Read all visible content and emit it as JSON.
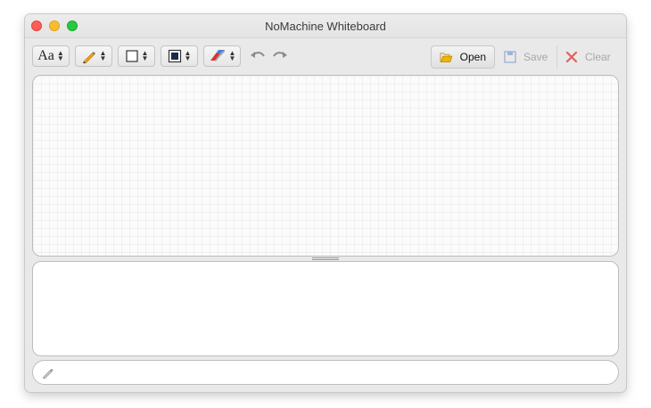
{
  "window": {
    "title": "NoMachine Whiteboard"
  },
  "toolbar": {
    "font_label": "Aa",
    "actions": {
      "open": "Open",
      "save": "Save",
      "clear": "Clear"
    }
  },
  "input": {
    "placeholder": "",
    "value": ""
  },
  "colors": {
    "pencil_accent": "#f0a020",
    "eraser_red": "#d8342e",
    "eraser_blue": "#4a7fd0",
    "folder_yellow": "#f2b400",
    "clear_red": "#e06060"
  },
  "icons": [
    "font-icon",
    "pencil-icon",
    "shape-icon",
    "fill-icon",
    "eraser-icon",
    "undo-icon",
    "redo-icon",
    "folder-icon",
    "save-icon",
    "clear-icon",
    "pencil-small-icon"
  ]
}
